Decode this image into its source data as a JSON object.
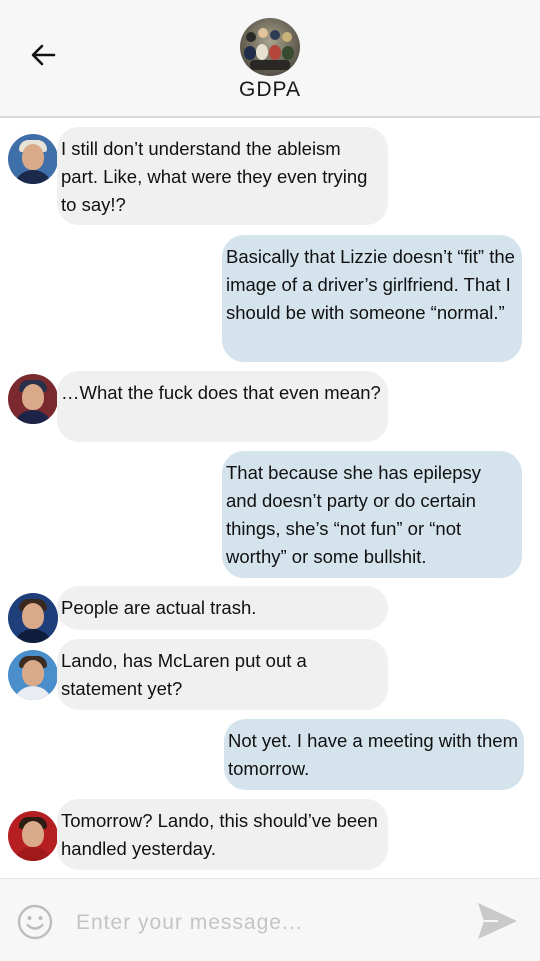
{
  "header": {
    "title": "GDPA",
    "back_icon": "arrow-left-icon",
    "avatar": "group-photo-avatar"
  },
  "messages": [
    {
      "side": "incoming",
      "sender_avatar": "driver-avatar-1",
      "text": "I still don’t understand the ableism part. Like, what were they even trying to say!?"
    },
    {
      "side": "outgoing",
      "text": "Basically that Lizzie doesn’t “fit” the image of a driver’s girlfriend. That I should be with someone “normal.”"
    },
    {
      "side": "incoming",
      "sender_avatar": "driver-avatar-2",
      "text": "…What the fuck does that even mean?"
    },
    {
      "side": "outgoing",
      "text": "That because she has epilepsy and doesn’t party or do certain things, she’s “not fun” or “not worthy” or some bullshit."
    },
    {
      "side": "incoming",
      "sender_avatar": "driver-avatar-3",
      "text": "People are actual trash."
    },
    {
      "side": "incoming",
      "sender_avatar": "driver-avatar-4",
      "text": " Lando, has McLaren put out a statement yet?"
    },
    {
      "side": "outgoing",
      "text": "Not yet. I have a meeting with them tomorrow."
    },
    {
      "side": "incoming",
      "sender_avatar": "driver-avatar-5",
      "text": "Tomorrow? Lando, this should’ve been handled yesterday."
    }
  ],
  "composer": {
    "placeholder": "Enter your message...",
    "value": "",
    "emoji_icon": "smiley-icon",
    "send_icon": "send-arrow-icon"
  },
  "colors": {
    "incoming_bubble": "#f0f0f0",
    "outgoing_bubble": "#d5e3ed",
    "header_bg": "#f7f7f7"
  }
}
